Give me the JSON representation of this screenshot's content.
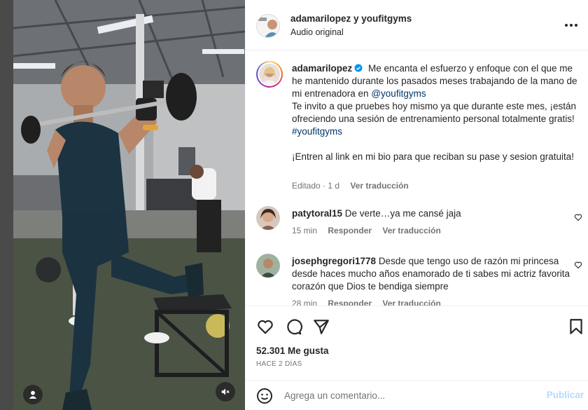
{
  "post": {
    "author": "adamarilopez",
    "collab_title": "adamarilopez y youfitgyms",
    "audio": "Audio original",
    "caption": {
      "line1_after_name": "Me encanta el esfuerzo y enfoque con el que me he mantenido durante los pasados meses trabajando de la mano de mi entrenadora en",
      "mention": "@youfitgyms",
      "line2": "Te invito a que pruebes hoy mismo ya que durante este mes, ¡están ofreciendo una sesión de entrenamiento personal totalmente gratis!",
      "hashtag": "#youfitgyms",
      "line3": "¡Entren al link en mi bio para que reciban su pase y sesion gratuita!",
      "edited": "Editado · 1 d",
      "translate": "Ver traducción"
    },
    "comments": [
      {
        "user": "patytoral15",
        "text": "De verte…ya me cansé jaja",
        "time": "15 min",
        "reply": "Responder",
        "translate": "Ver traducción"
      },
      {
        "user": "josephgregori1778",
        "text": "Desde que tengo uso de razón mi princesa desde haces mucho años enamorado de ti sabes mi actriz favorita corazón que Dios te bendiga siempre",
        "time": "28 min",
        "reply": "Responder",
        "translate": "Ver traducción"
      }
    ],
    "likes": "52.301 Me gusta",
    "time_ago": "HACE 2 DÍAS",
    "composer": {
      "placeholder": "Agrega un comentario...",
      "post_label": "Publicar"
    },
    "icons": {
      "like": "heart-icon",
      "comment": "comment-icon",
      "share": "share-icon",
      "save": "bookmark-icon",
      "more": "more-options-icon",
      "verified": "verified-badge-icon",
      "emoji": "emoji-icon",
      "mute": "muted-speaker-icon",
      "tag": "user-tag-icon"
    },
    "colors": {
      "link": "#00376b",
      "verified": "#0095f6",
      "post_disabled": "#b3dbff",
      "muted_text": "#737373"
    }
  }
}
